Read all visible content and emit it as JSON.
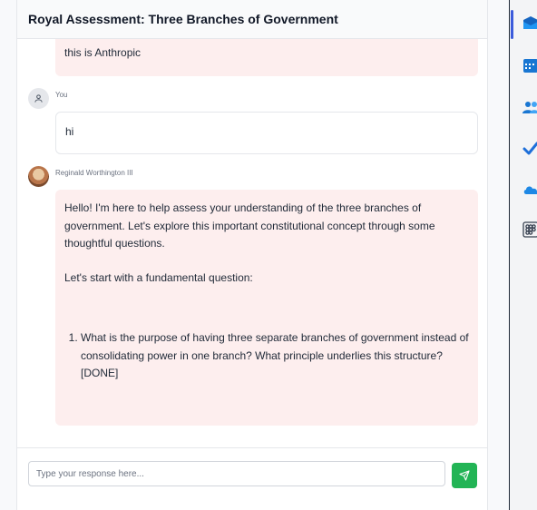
{
  "chat": {
    "title": "Royal Assessment: Three Branches of Government",
    "messages": {
      "prev_bot_tail": "this is Anthropic",
      "user": {
        "name": "You",
        "text": "hi"
      },
      "bot": {
        "name": "Reginald Worthington III",
        "intro": "Hello! I'm here to help assess your understanding of the three branches of government. Let's explore this important constitutional concept through some thoughtful questions.",
        "lead": "Let's start with a fundamental question:",
        "questions": [
          "What is the purpose of having three separate branches of government instead of consolidating power in one branch? What principle underlies this structure? [DONE]"
        ]
      }
    },
    "input": {
      "placeholder": "Type your response here...",
      "value": ""
    },
    "send_icon": "send-icon"
  },
  "rail": {
    "icons": [
      "outlook-icon",
      "calendar-icon",
      "people-icon",
      "todo-icon",
      "onedrive-icon",
      "apps-grid-icon"
    ]
  },
  "colors": {
    "bot_bubble": "#fdeeee",
    "send_button": "#22b455",
    "header_bg": "#f9fafb"
  }
}
